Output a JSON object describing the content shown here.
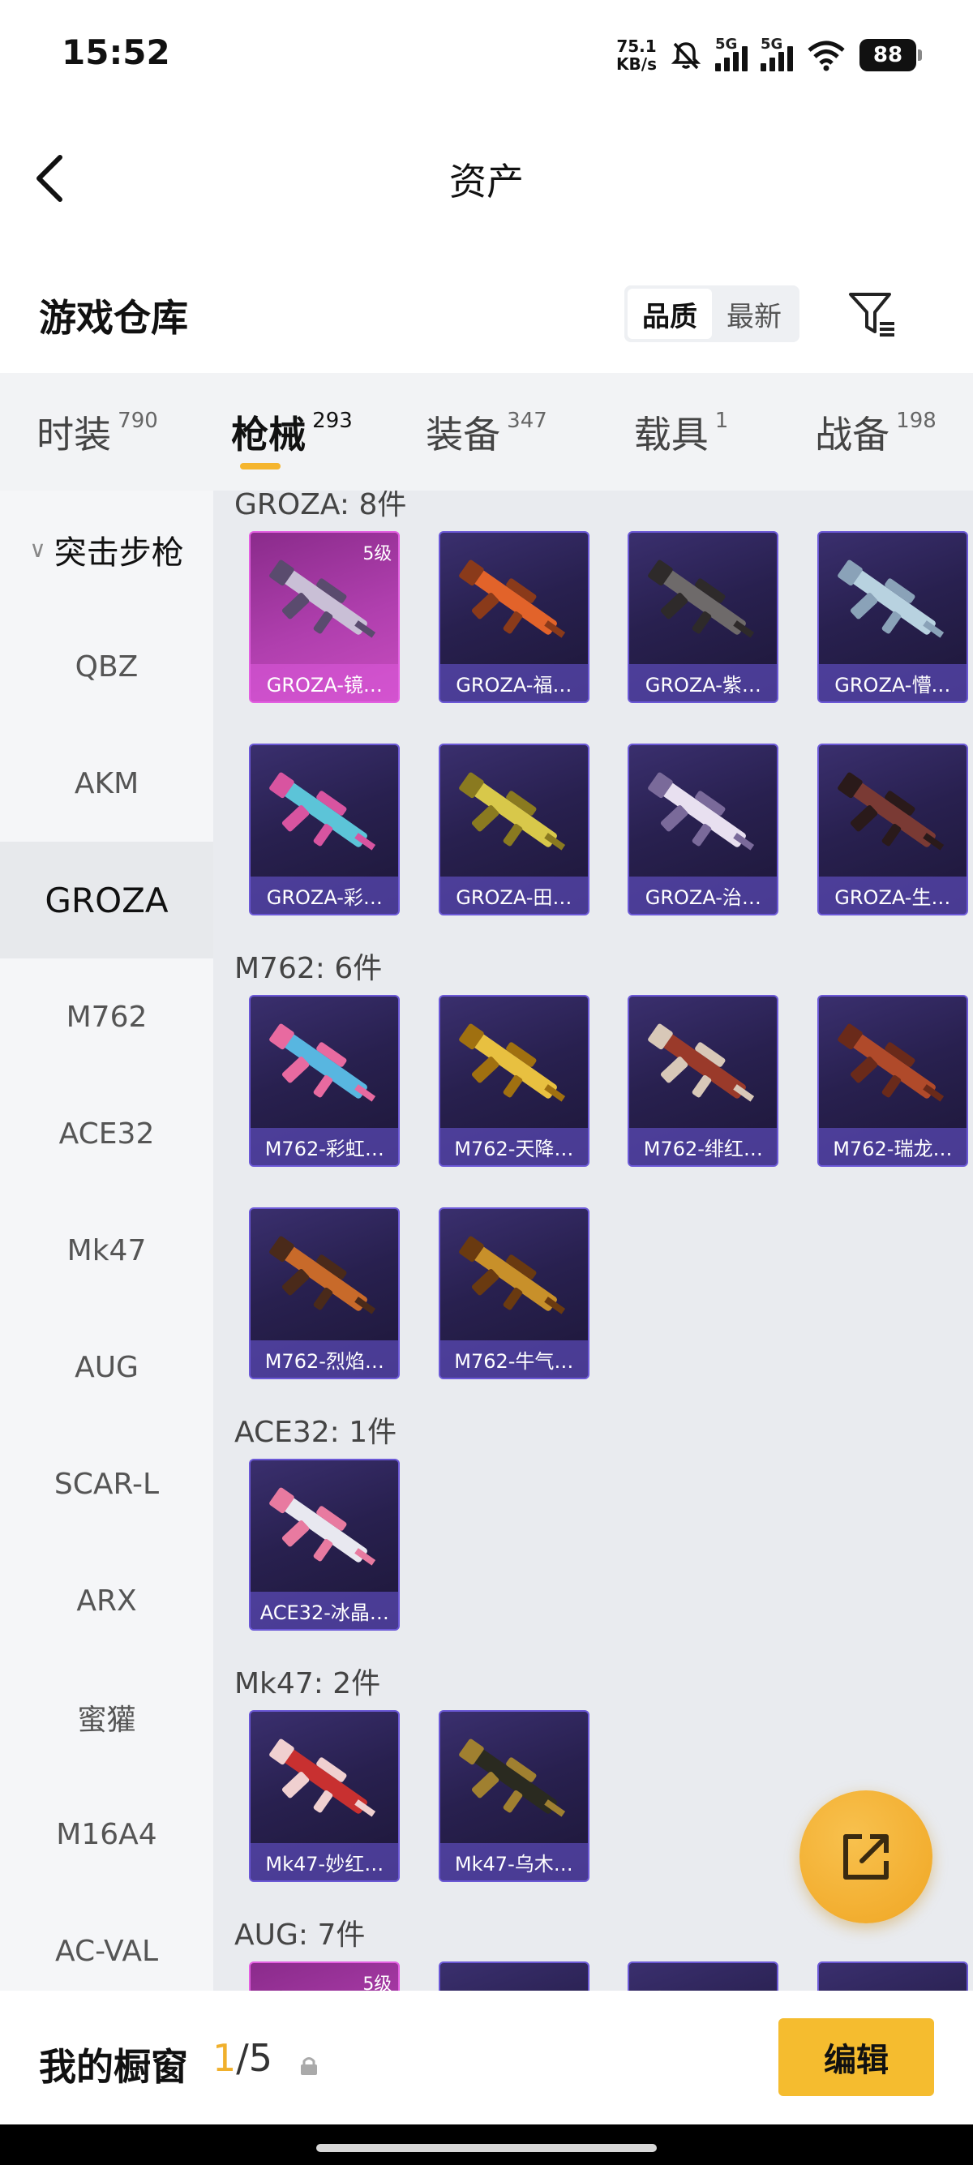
{
  "status": {
    "time": "15:52",
    "net_speed_value": "75.1",
    "net_speed_unit": "KB/s",
    "sim1": "5G",
    "sim2": "5G",
    "battery": "88"
  },
  "header": {
    "title": "资产"
  },
  "section": {
    "title": "游戏仓库",
    "sort_quality": "品质",
    "sort_newest": "最新"
  },
  "tabs": [
    {
      "label": "时装",
      "count": "790"
    },
    {
      "label": "枪械",
      "count": "293",
      "active": true
    },
    {
      "label": "装备",
      "count": "347"
    },
    {
      "label": "载具",
      "count": "1"
    },
    {
      "label": "战备",
      "count": "198"
    }
  ],
  "sidebar": {
    "category": "突击步枪",
    "items": [
      "QBZ",
      "AKM",
      "GROZA",
      "M762",
      "ACE32",
      "Mk47",
      "AUG",
      "SCAR-L",
      "ARX",
      "蜜獾",
      "M16A4",
      "AC-VAL"
    ],
    "active": "GROZA"
  },
  "groups": [
    {
      "title": "GROZA: 8件",
      "items": [
        {
          "name": "GROZA-镜…",
          "rarity": "purple",
          "level": "5级"
        },
        {
          "name": "GROZA-福…"
        },
        {
          "name": "GROZA-紫…"
        },
        {
          "name": "GROZA-懵…"
        },
        {
          "name": "GROZA-彩…"
        },
        {
          "name": "GROZA-田…"
        },
        {
          "name": "GROZA-治…"
        },
        {
          "name": "GROZA-生…"
        }
      ]
    },
    {
      "title": "M762: 6件",
      "items": [
        {
          "name": "M762-彩虹…"
        },
        {
          "name": "M762-天降…"
        },
        {
          "name": "M762-绯红…"
        },
        {
          "name": "M762-瑞龙…"
        },
        {
          "name": "M762-烈焰…"
        },
        {
          "name": "M762-牛气…"
        }
      ]
    },
    {
      "title": "ACE32: 1件",
      "items": [
        {
          "name": "ACE32-冰晶…"
        }
      ]
    },
    {
      "title": "Mk47: 2件",
      "items": [
        {
          "name": "Mk47-妙红…"
        },
        {
          "name": "Mk47-乌木…"
        }
      ]
    },
    {
      "title": "AUG: 7件",
      "items": [
        {
          "name": "",
          "rarity": "purple",
          "level": "5级"
        },
        {
          "name": ""
        },
        {
          "name": ""
        },
        {
          "name": ""
        }
      ]
    }
  ],
  "bottom": {
    "label": "我的橱窗",
    "current": "1",
    "total": "/5",
    "edit": "编辑"
  },
  "colors": {
    "accent": "#f5bc2f",
    "card_border": "#6b58d6",
    "card_purple": "#c84dbf"
  }
}
